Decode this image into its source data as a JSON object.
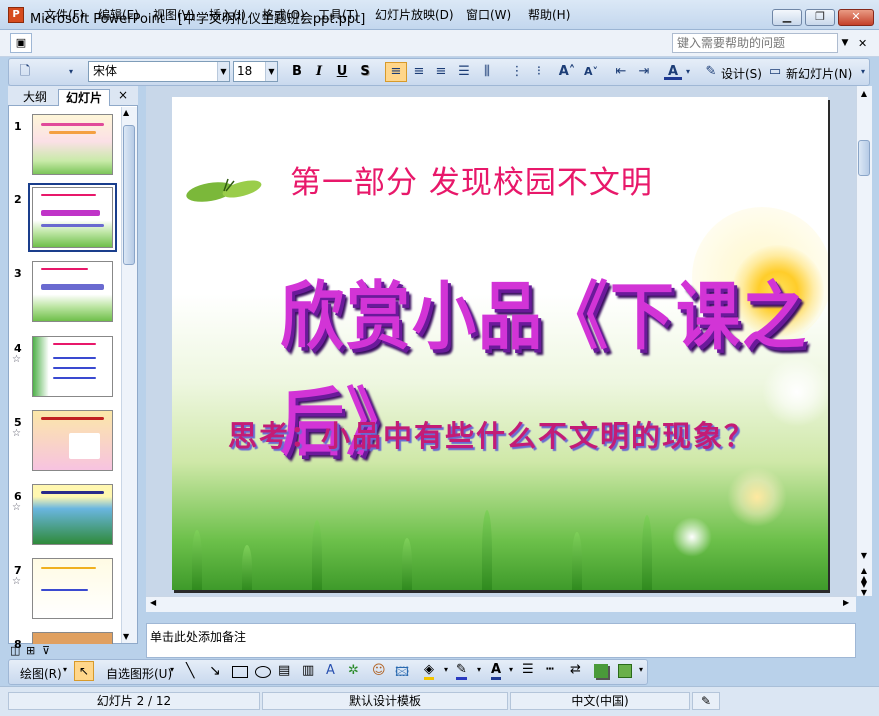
{
  "window": {
    "app_name": "Microsoft PowerPoint",
    "title": "Microsoft PowerPoint - [中学文明礼仪主题班会ppt.ppt]",
    "minimize_icon": "minimize-icon",
    "restore_icon": "restore-icon",
    "close_icon": "close-icon"
  },
  "menu": {
    "items": [
      "文件(F)",
      "编辑(E)",
      "视图(V)",
      "插入(I)",
      "格式(O)",
      "工具(T)",
      "幻灯片放映(D)",
      "窗口(W)",
      "帮助(H)"
    ],
    "help_placeholder": "键入需要帮助的问题"
  },
  "toolbar": {
    "font_name": "宋体",
    "font_size": "18",
    "bold": "B",
    "italic": "I",
    "underline": "U",
    "shadow": "S",
    "design_label": "设计(S)",
    "new_slide_label": "新幻灯片(N)"
  },
  "panel": {
    "tab_outline": "大纲",
    "tab_slides": "幻灯片",
    "close": "×",
    "thumbnails": [
      {
        "num": "1",
        "star": ""
      },
      {
        "num": "2",
        "star": ""
      },
      {
        "num": "3",
        "star": ""
      },
      {
        "num": "4",
        "star": "☆"
      },
      {
        "num": "5",
        "star": "☆"
      },
      {
        "num": "6",
        "star": "☆"
      },
      {
        "num": "7",
        "star": "☆"
      },
      {
        "num": "8",
        "star": ""
      }
    ],
    "selected_index": 2
  },
  "slide": {
    "heading": "第一部分 发现校园不文明",
    "title": "欣赏小品《下课之后》",
    "question": "思考：小品中有些什么不文明的现象？"
  },
  "notes": {
    "placeholder": "单击此处添加备注"
  },
  "drawbar": {
    "draw_label": "绘图(R)",
    "autoshape_label": "自选图形(U)"
  },
  "status": {
    "slide_position": "幻灯片 2 / 12",
    "template": "默认设计模板",
    "language": "中文(中国)"
  }
}
